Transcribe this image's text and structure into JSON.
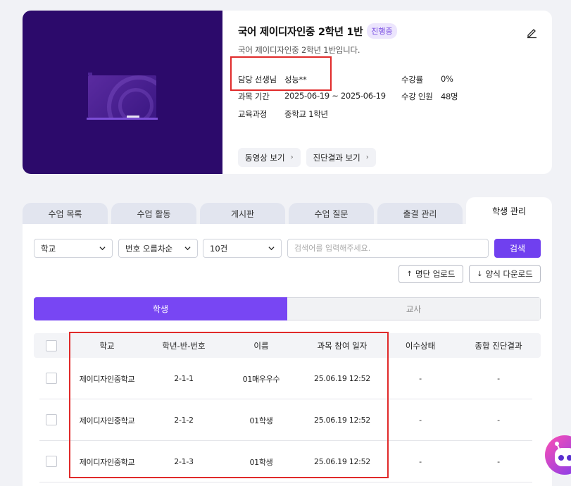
{
  "course": {
    "title": "국어 제이디자인중 2학년 1반",
    "status_badge": "진행중",
    "subtitle": "국어 제이디자인중 2학년 1반입니다.",
    "teacher_label": "담당 선생님",
    "teacher_value": "성능**",
    "period_label": "과목 기간",
    "period_value": "2025-06-19 ~ 2025-06-19",
    "curriculum_label": "교육과정",
    "curriculum_value": "중학교 1학년",
    "completion_label": "수강률",
    "completion_value": "0%",
    "enroll_label": "수강 인원",
    "enroll_value": "48명",
    "video_button": "동영상 보기",
    "diagnosis_button": "진단결과 보기"
  },
  "tabs": [
    "수업 목록",
    "수업 활동",
    "게시판",
    "수업 질문",
    "출결 관리",
    "학생 관리"
  ],
  "active_tab": "학생 관리",
  "filters": {
    "school_select": "학교",
    "sort_select": "번호 오름차순",
    "count_select": "10건",
    "search_placeholder": "검색어를 입력해주세요.",
    "search_button": "검색"
  },
  "actions": {
    "upload_button": "명단 업로드",
    "download_button": "양식 다운로드"
  },
  "segment": {
    "students": "학생",
    "teachers": "교사"
  },
  "table": {
    "headers": [
      "학교",
      "학년-반-번호",
      "이름",
      "과목 참여 일자",
      "이수상태",
      "종합 진단결과"
    ],
    "rows": [
      [
        "제이디자인중학교",
        "2-1-1",
        "01매우우수",
        "25.06.19 12:52",
        "-",
        "-"
      ],
      [
        "제이디자인중학교",
        "2-1-2",
        "01학생",
        "25.06.19 12:52",
        "-",
        "-"
      ],
      [
        "제이디자인중학교",
        "2-1-3",
        "01학생",
        "25.06.19 12:52",
        "-",
        "-"
      ]
    ]
  },
  "colors": {
    "accent": "#7846f3",
    "thumbnail": "#2c0a6b",
    "highlight": "#e02a2a"
  }
}
